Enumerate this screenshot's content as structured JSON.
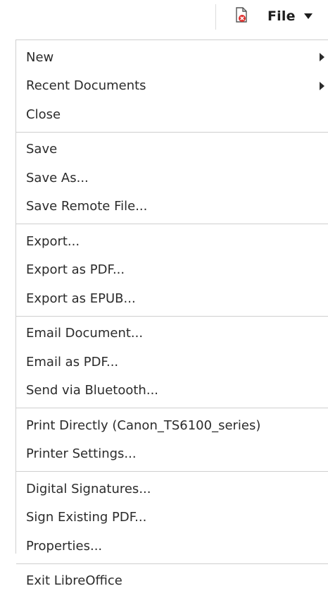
{
  "toolbar": {
    "doc_icon": "document-error-icon",
    "file_label": "File",
    "caret_icon": "caret-down-icon"
  },
  "menu": {
    "groups": [
      {
        "items": [
          {
            "label": "New",
            "submenu": true
          },
          {
            "label": "Recent Documents",
            "submenu": true
          },
          {
            "label": "Close",
            "submenu": false
          }
        ]
      },
      {
        "items": [
          {
            "label": "Save",
            "submenu": false
          },
          {
            "label": "Save As...",
            "submenu": false
          },
          {
            "label": "Save Remote File...",
            "submenu": false
          }
        ]
      },
      {
        "items": [
          {
            "label": "Export...",
            "submenu": false
          },
          {
            "label": "Export as PDF...",
            "submenu": false
          },
          {
            "label": "Export as EPUB...",
            "submenu": false
          }
        ]
      },
      {
        "items": [
          {
            "label": "Email Document...",
            "submenu": false
          },
          {
            "label": "Email as PDF...",
            "submenu": false
          },
          {
            "label": "Send via Bluetooth...",
            "submenu": false
          }
        ]
      },
      {
        "items": [
          {
            "label": "Print Directly (Canon_TS6100_series)",
            "submenu": false
          },
          {
            "label": "Printer Settings...",
            "submenu": false
          }
        ]
      },
      {
        "items": [
          {
            "label": "Digital Signatures...",
            "submenu": false
          },
          {
            "label": "Sign Existing PDF...",
            "submenu": false
          },
          {
            "label": "Properties...",
            "submenu": false
          }
        ]
      },
      {
        "items": [
          {
            "label": "Exit LibreOffice",
            "submenu": false
          }
        ]
      }
    ]
  },
  "colors": {
    "accent_red": "#e0312f",
    "text": "#2b2b2b",
    "separator": "#cfcfcf"
  }
}
